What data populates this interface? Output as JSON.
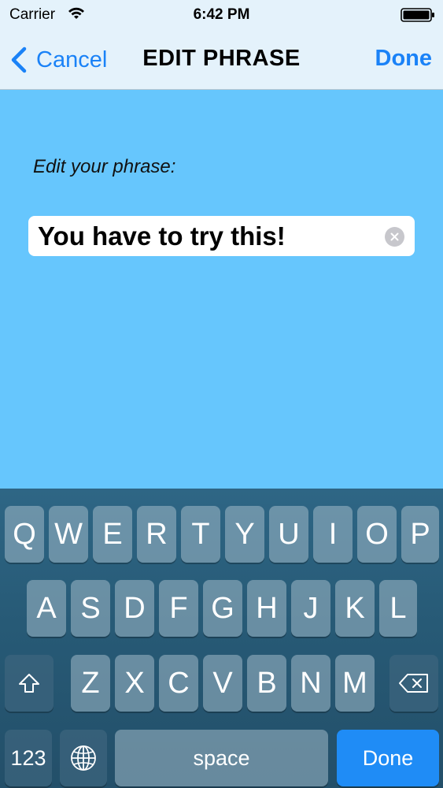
{
  "status": {
    "carrier": "Carrier",
    "time": "6:42 PM",
    "wifi_icon": "wifi-icon",
    "battery_icon": "battery-icon"
  },
  "nav": {
    "cancel_label": "Cancel",
    "title": "EDIT PHRASE",
    "done_label": "Done",
    "back_icon": "chevron-left-icon"
  },
  "form": {
    "prompt": "Edit your phrase:",
    "value": "You have to try this!",
    "clear_icon": "clear-icon"
  },
  "keyboard": {
    "row1": [
      "Q",
      "W",
      "E",
      "R",
      "T",
      "Y",
      "U",
      "I",
      "O",
      "P"
    ],
    "row2": [
      "A",
      "S",
      "D",
      "F",
      "G",
      "H",
      "J",
      "K",
      "L"
    ],
    "row3": [
      "Z",
      "X",
      "C",
      "V",
      "B",
      "N",
      "M"
    ],
    "numbers_label": "123",
    "space_label": "space",
    "done_label": "Done",
    "shift_icon": "shift-icon",
    "delete_icon": "delete-icon",
    "globe_icon": "globe-icon"
  },
  "colors": {
    "accent": "#1a82f7",
    "background": "#66c6fd",
    "nav_background": "#e4f2fb",
    "keyboard_done": "#1f8cf6"
  }
}
